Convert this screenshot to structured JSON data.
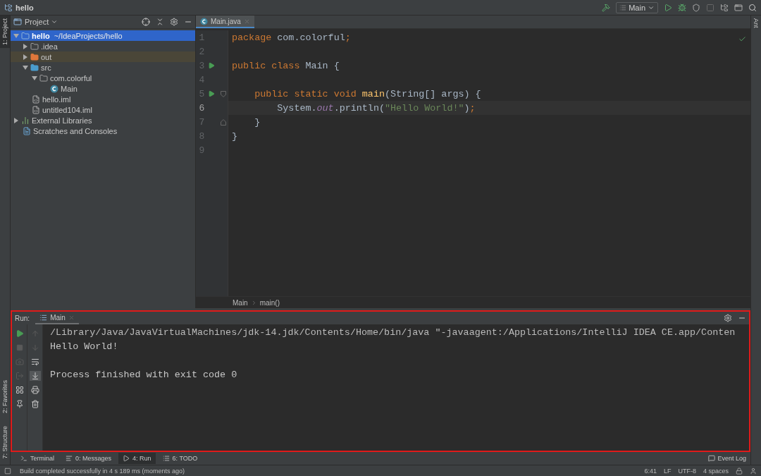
{
  "window": {
    "title": "hello"
  },
  "toolbar": {
    "run_config": "Main"
  },
  "left_stripe": [
    {
      "label": "1: Project",
      "selected": true
    }
  ],
  "left_stripe_bottom": [
    {
      "label": "2: Favorites",
      "selected": false
    },
    {
      "label": "7: Structure",
      "selected": false
    }
  ],
  "right_stripe": [
    {
      "label": "Ant",
      "selected": false
    }
  ],
  "project_panel": {
    "title": "Project",
    "tree": [
      {
        "label": "hello",
        "detail": "~/IdeaProjects/hello",
        "kind": "module",
        "expanded": true,
        "selected": true,
        "children": [
          {
            "label": ".idea",
            "kind": "folder",
            "expanded": false,
            "selected": false
          },
          {
            "label": "out",
            "kind": "excluded",
            "expanded": false,
            "selected": false
          },
          {
            "label": "src",
            "kind": "source",
            "expanded": true,
            "selected": false,
            "children": [
              {
                "label": "com.colorful",
                "kind": "package",
                "expanded": true,
                "selected": false,
                "children": [
                  {
                    "label": "Main",
                    "kind": "class",
                    "selected": false
                  }
                ]
              }
            ]
          },
          {
            "label": "hello.iml",
            "kind": "file",
            "selected": false
          },
          {
            "label": "untitled104.iml",
            "kind": "file",
            "selected": false
          }
        ]
      },
      {
        "label": "External Libraries",
        "kind": "library",
        "expanded": false,
        "selected": false
      },
      {
        "label": "Scratches and Consoles",
        "kind": "scratches",
        "selected": false
      }
    ]
  },
  "editor": {
    "tabs": [
      {
        "label": "Main.java",
        "selected": true
      }
    ],
    "lines": [
      {
        "number": "1",
        "run": false,
        "current": false,
        "tokens": [
          {
            "text": "package",
            "kind": "keyword"
          },
          {
            "text": " com.colorful",
            "kind": "plain"
          },
          {
            "text": ";",
            "kind": "punct"
          }
        ]
      },
      {
        "number": "2",
        "run": false,
        "current": false
      },
      {
        "number": "3",
        "run": true,
        "current": false,
        "tokens": [
          {
            "text": "public class",
            "kind": "keyword"
          },
          {
            "text": " Main {",
            "kind": "plain"
          }
        ]
      },
      {
        "number": "4",
        "run": false,
        "current": false
      },
      {
        "number": "5",
        "run": true,
        "current": false,
        "fold_start": true,
        "tokens": [
          {
            "text": "    public static void ",
            "kind": "keyword"
          },
          {
            "text": "main",
            "kind": "method"
          },
          {
            "text": "(String[] args) {",
            "kind": "plain"
          }
        ]
      },
      {
        "number": "6",
        "run": false,
        "current": true,
        "tokens": [
          {
            "text": "        System.",
            "kind": "plain"
          },
          {
            "text": "out",
            "kind": "field"
          },
          {
            "text": ".println(",
            "kind": "plain"
          },
          {
            "text": "\"Hello World!\"",
            "kind": "string"
          },
          {
            "text": ")",
            "kind": "plain"
          },
          {
            "text": ";",
            "kind": "punct"
          }
        ]
      },
      {
        "number": "7",
        "run": false,
        "current": false,
        "fold_end": true,
        "tokens": [
          {
            "text": "    }",
            "kind": "plain"
          }
        ]
      },
      {
        "number": "8",
        "run": false,
        "current": false,
        "tokens": [
          {
            "text": "}",
            "kind": "plain"
          }
        ]
      },
      {
        "number": "9",
        "run": false,
        "current": false
      }
    ],
    "breadcrumbs": [
      "Main",
      "main()"
    ]
  },
  "run_panel": {
    "label": "Run:",
    "tabs": [
      {
        "label": "Main",
        "selected": true
      }
    ],
    "console": [
      {
        "kind": "command",
        "text": "/Library/Java/JavaVirtualMachines/jdk-14.jdk/Contents/Home/bin/java \"-javaagent:/Applications/IntelliJ IDEA CE.app/Conten"
      },
      {
        "kind": "output",
        "text": "Hello World!"
      },
      {
        "kind": "blank"
      },
      {
        "kind": "output",
        "text": "Process finished with exit code 0"
      }
    ]
  },
  "bottom_tabs": [
    {
      "label": "Terminal",
      "selected": false
    },
    {
      "label": "0: Messages",
      "selected": false
    },
    {
      "label": "4: Run",
      "selected": true
    },
    {
      "label": "6: TODO",
      "selected": false
    }
  ],
  "event_log": "Event Log",
  "status_bar": {
    "message": "Build completed successfully in 4 s 189 ms (moments ago)",
    "items": [
      "6:41",
      "LF",
      "UTF-8",
      "4 spaces"
    ]
  }
}
